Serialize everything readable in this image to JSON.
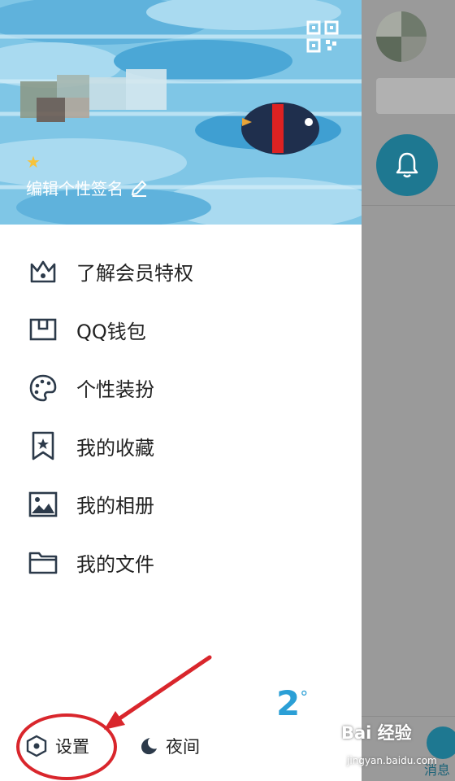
{
  "profile": {
    "signature": "编辑个性签名",
    "star_icon": "star-icon",
    "qr_icon": "qr-code-icon"
  },
  "menu": [
    {
      "id": "vip",
      "label": "了解会员特权",
      "icon": "crown-icon"
    },
    {
      "id": "wallet",
      "label": "QQ钱包",
      "icon": "wallet-icon"
    },
    {
      "id": "theme",
      "label": "个性装扮",
      "icon": "palette-icon"
    },
    {
      "id": "favorites",
      "label": "我的收藏",
      "icon": "bookmark-star-icon"
    },
    {
      "id": "album",
      "label": "我的相册",
      "icon": "image-icon"
    },
    {
      "id": "files",
      "label": "我的文件",
      "icon": "folder-icon"
    }
  ],
  "bottom_bar": {
    "settings_label": "设置",
    "night_label": "夜间",
    "weather_temp": "2",
    "weather_unit": "°"
  },
  "main_app": {
    "tab_label": "消息"
  },
  "watermark": {
    "brand": "Bai 经验",
    "url": "jingyan.baidu.com"
  },
  "colors": {
    "accent": "#1e7891",
    "header_bg": "#7fc6e6",
    "annotation_red": "#d9262c"
  }
}
